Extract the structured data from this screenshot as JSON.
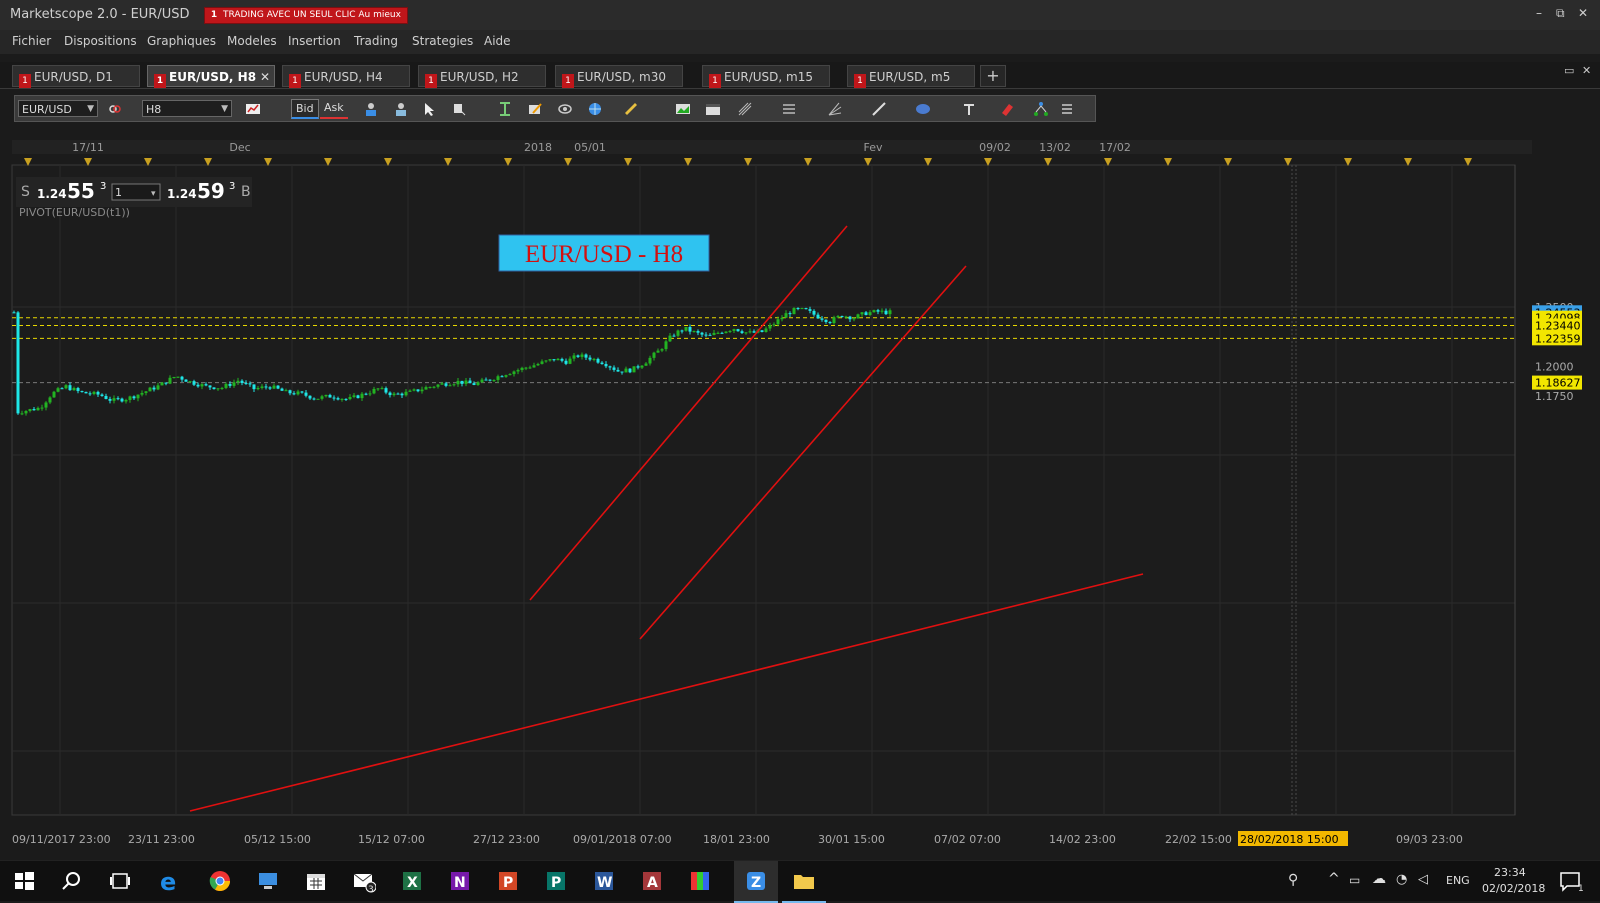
{
  "window": {
    "title": "Marketscope 2.0 - EUR/USD",
    "promo_badge": "1",
    "promo_text": "TRADING AVEC UN SEUL CLIC Au mieux",
    "controls": [
      "–",
      "⧉",
      "✕"
    ]
  },
  "menu": [
    "Fichier",
    "Dispositions",
    "Graphiques",
    "Modeles",
    "Insertion",
    "Trading",
    "Strategies",
    "Aide"
  ],
  "tabs": [
    {
      "label": "EUR/USD, D1",
      "active": false
    },
    {
      "label": "EUR/USD, H8",
      "active": true
    },
    {
      "label": "EUR/USD, H4",
      "active": false
    },
    {
      "label": "EUR/USD, H2",
      "active": false
    },
    {
      "label": "EUR/USD, m30",
      "active": false
    },
    {
      "label": "EUR/USD, m15",
      "active": false
    },
    {
      "label": "EUR/USD, m5",
      "active": false
    }
  ],
  "tab_badge": "1",
  "tab_close": "✕",
  "tab_add": "+",
  "toolbar": {
    "instrument": "EUR/USD",
    "timeframe": "H8",
    "bid": "Bid",
    "ask": "Ask"
  },
  "quote": {
    "sell_label": "S",
    "sell_small": "1.24",
    "sell_big": "55",
    "sell_sup": "3",
    "amount": "1",
    "buy_small": "1.24",
    "buy_big": "59",
    "buy_sup": "3",
    "buy_label": "B"
  },
  "indicator_label": "PIVOT(EUR/USD(t1))",
  "chart_title": "EUR/USD - H8",
  "top_dates": [
    "17/11",
    "Dec",
    "2018",
    "05/01",
    "Fev",
    "09/02",
    "13/02",
    "17/02"
  ],
  "price_labels": [
    "1.2500",
    "1.2000",
    "1.1750"
  ],
  "price_tags": [
    {
      "value": "1.24553",
      "color": "#3aa0e8"
    },
    {
      "value": "1.24098",
      "color": "#f2e600"
    },
    {
      "value": "1.23440",
      "color": "#f2e600"
    },
    {
      "value": "1.22359",
      "color": "#f2e600"
    },
    {
      "value": "1.18627",
      "color": "#f2e600"
    }
  ],
  "bottom_dates": [
    "09/11/2017 23:00",
    "23/11 23:00",
    "05/12 15:00",
    "15/12 07:00",
    "27/12 23:00",
    "09/01/2018 07:00",
    "18/01 23:00",
    "30/01 15:00",
    "07/02 07:00",
    "14/02 23:00",
    "22/02 15:00",
    "09/03 23:00"
  ],
  "cursor_date": "28/02/2018 15:00",
  "taskbar": {
    "lang": "ENG",
    "time": "23:34",
    "date": "02/02/2018",
    "notif_count": "1",
    "mail_count": "3"
  },
  "colors": {
    "bull": "#22b322",
    "bear": "#1ee6e6",
    "trendline": "#e01010",
    "pivot": "#e8d800"
  }
}
